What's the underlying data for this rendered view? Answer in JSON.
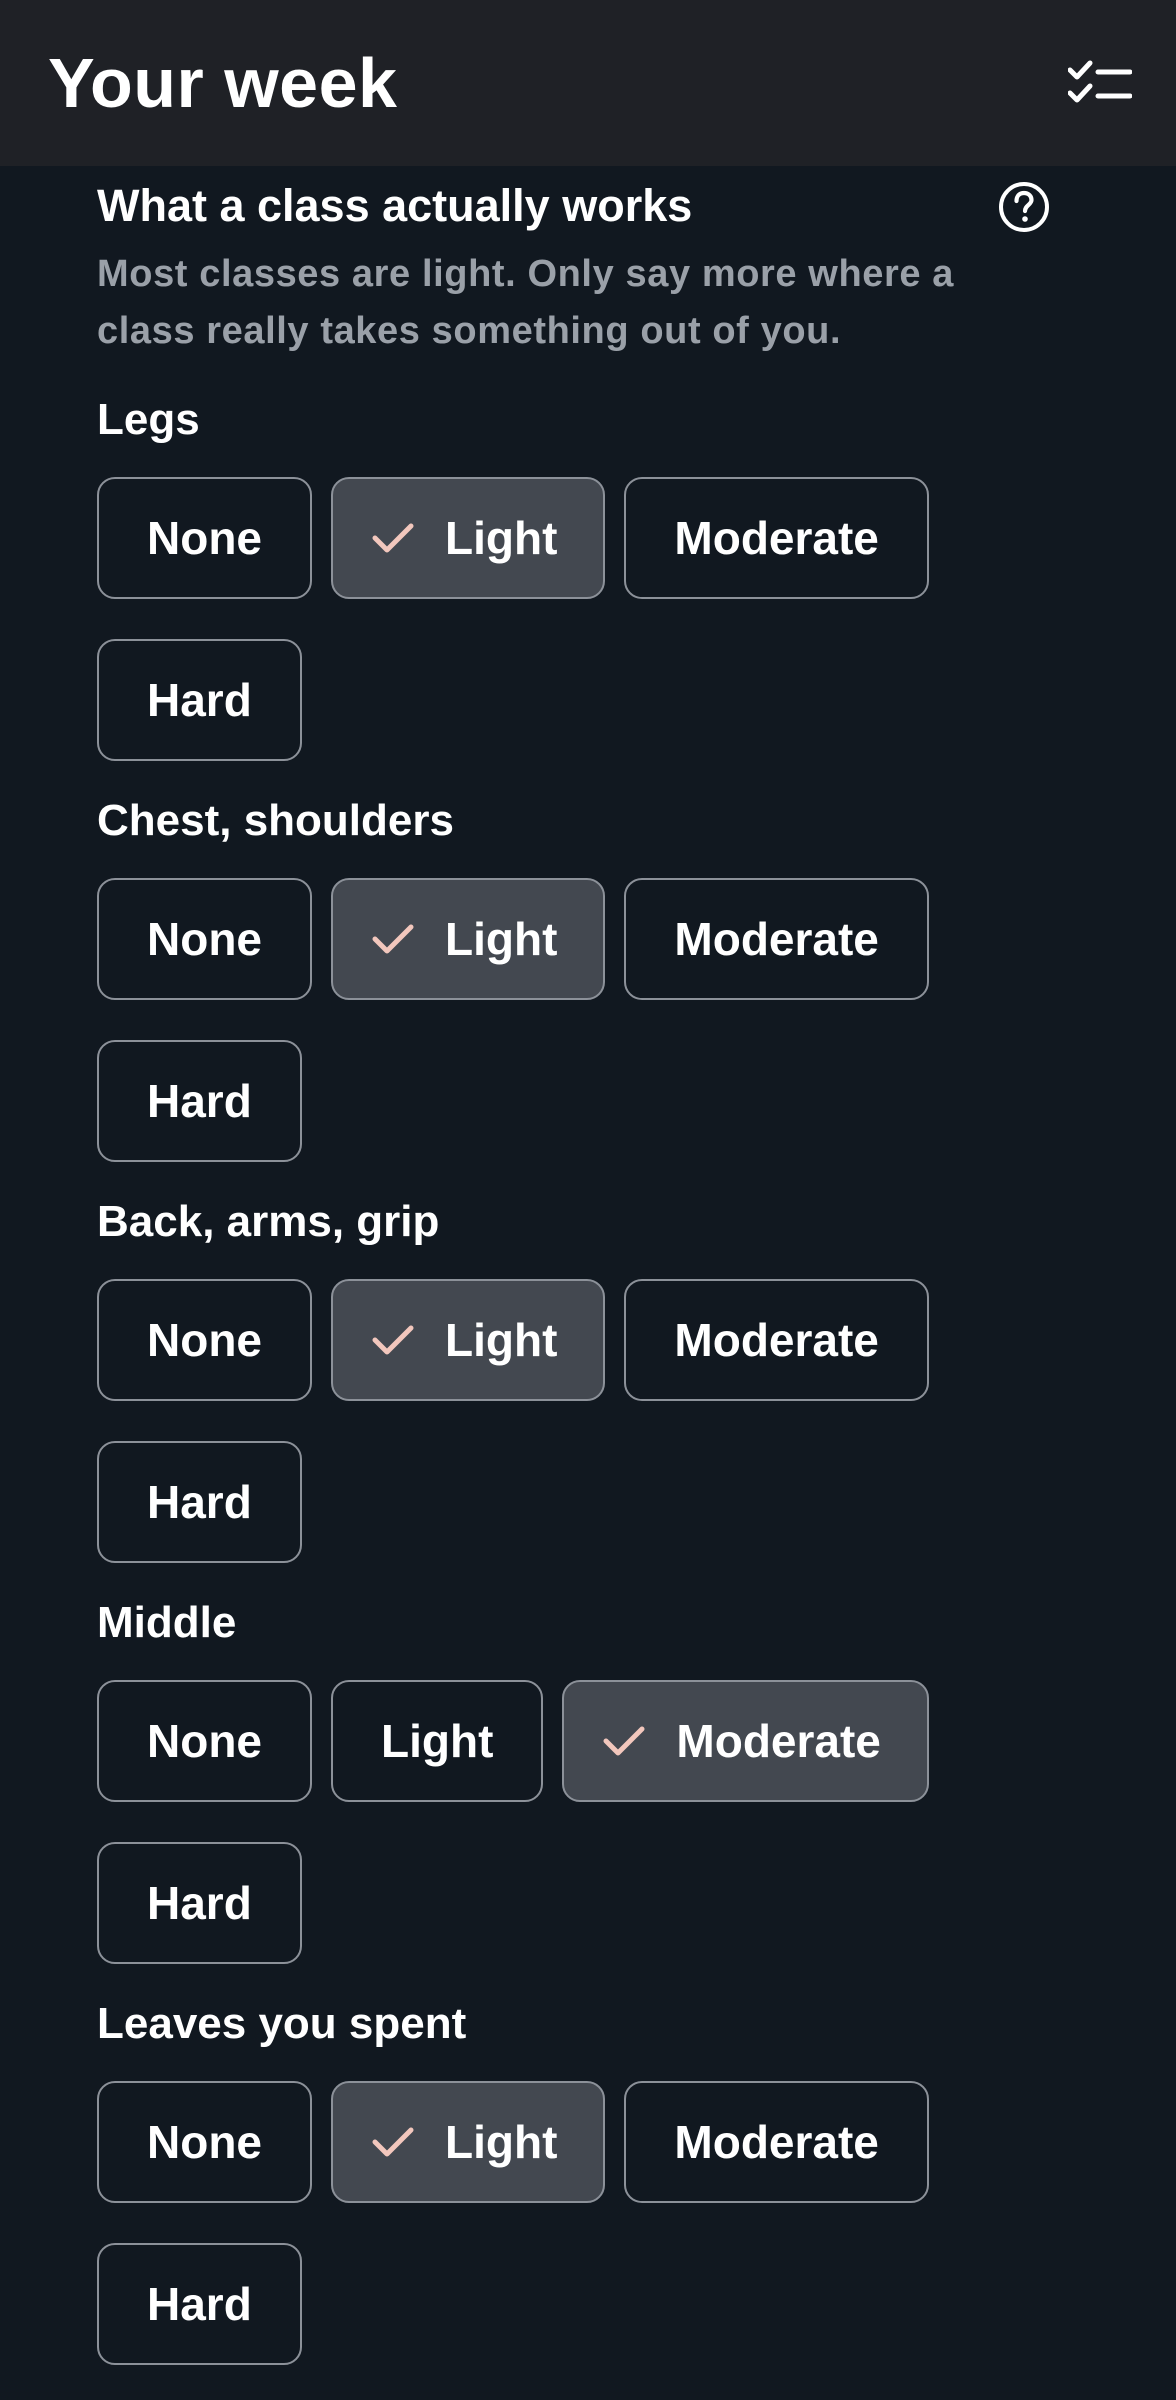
{
  "app_bar": {
    "title": "Your week",
    "action_icon": "checklist-icon"
  },
  "section": {
    "title": "What a class actually works",
    "help_icon": "help-circle-icon",
    "description": "Most classes are light. Only say more where a class really takes something out of you."
  },
  "options": [
    "None",
    "Light",
    "Moderate",
    "Hard"
  ],
  "groups": [
    {
      "label": "Legs",
      "selected": "Light"
    },
    {
      "label": "Chest, shoulders",
      "selected": "Light"
    },
    {
      "label": "Back, arms, grip",
      "selected": "Light"
    },
    {
      "label": "Middle",
      "selected": "Moderate"
    },
    {
      "label": "Leaves you spent",
      "selected": "Light"
    }
  ],
  "colors": {
    "background": "#111820",
    "app_bar": "#1f2126",
    "chip_selected": "#434850",
    "chip_border": "#8c9199",
    "check_mark": "#f2c7bd",
    "muted_text": "#9aa0a8"
  }
}
